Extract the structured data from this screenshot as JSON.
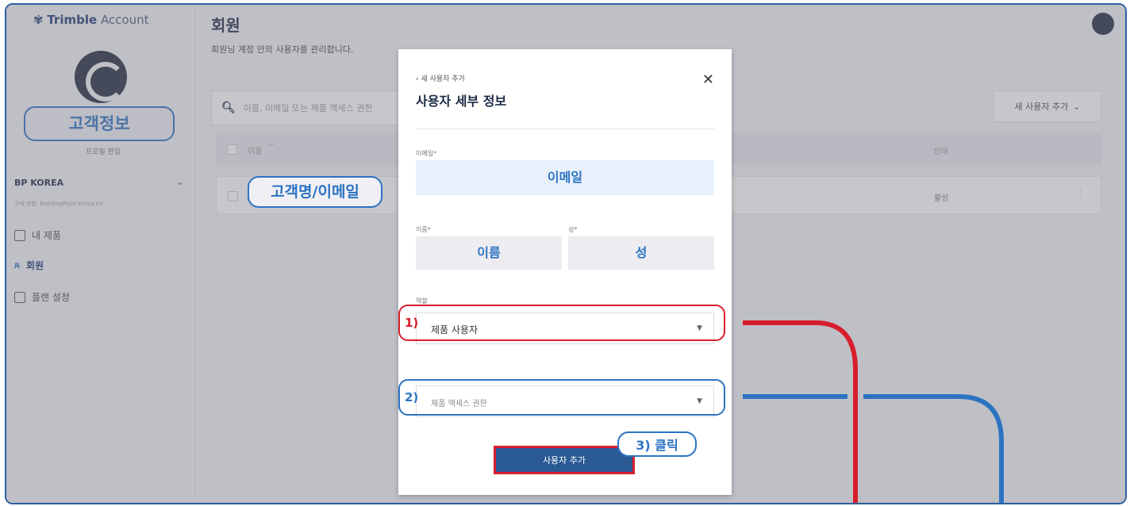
{
  "sidebar": {
    "brand_bold": "Trimble",
    "brand_thin": "Account",
    "profile_edit": "프로필 편집",
    "org_name": "BP KOREA",
    "org_sub": "구매 방법: BuildingPoint Korea Inc",
    "nav": [
      {
        "label": "내 제품"
      },
      {
        "label": "회원"
      },
      {
        "label": "플랜 설정"
      }
    ]
  },
  "main": {
    "title": "회원",
    "subtitle": "회원님 계정 안의 사용자를 관리합니다.",
    "search_placeholder": "이름, 이메일 또는 제품 액세스 권한",
    "add_user_button": "새 사용자 추가",
    "table": {
      "col_name": "이름",
      "col_status": "상태",
      "row_status": "활성"
    }
  },
  "modal": {
    "back_label": "새 사용자 추가",
    "title": "사용자 세부 정보",
    "email_label": "이메일*",
    "first_name_label": "이름*",
    "last_name_label": "성*",
    "role_label": "역할",
    "role_value": "제품 사용자",
    "access_placeholder": "제품 액세스 권한",
    "submit_label": "사용자 추가"
  },
  "annotations": {
    "customer_info": "고객정보",
    "customer_name_email": "고객명/이메일",
    "email": "이메일",
    "first_name": "이름",
    "last_name": "성",
    "step1": "1)",
    "step2": "2)",
    "step3": "3) 클릭",
    "red_color": "#d81e2c",
    "blue_color": "#2c73c2"
  }
}
